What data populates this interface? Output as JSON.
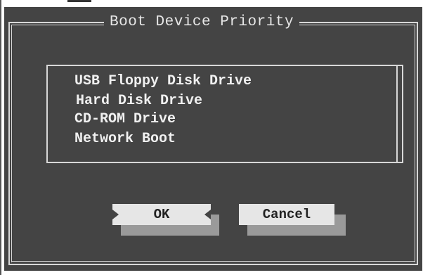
{
  "dialog": {
    "title": "Boot Device Priority"
  },
  "boot_list": {
    "items": [
      "USB Floppy Disk Drive",
      "Hard Disk Drive",
      "CD-ROM Drive",
      "Network Boot"
    ]
  },
  "buttons": {
    "ok_label": "OK",
    "cancel_label": "Cancel",
    "selected": "OK"
  },
  "colors": {
    "dialog_background": "#444444",
    "frame_line": "#d8d8d8",
    "text": "#f0f0f0",
    "button_face": "#e6e6e6",
    "button_shadow": "#9a9a9a"
  }
}
